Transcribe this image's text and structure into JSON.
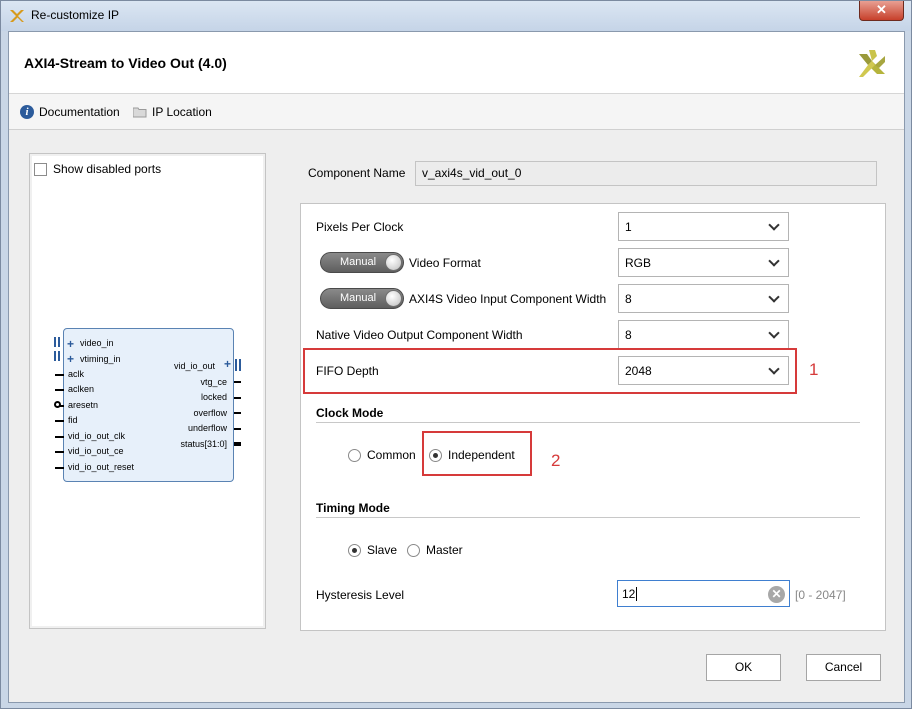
{
  "window": {
    "title": "Re-customize IP",
    "close_glyph": "✕"
  },
  "header": {
    "ip_title": "AXI4-Stream to Video Out (4.0)",
    "logo_icon": "xilinx-logo-icon"
  },
  "toolbar": {
    "documentation": "Documentation",
    "ip_location": "IP Location"
  },
  "symbol": {
    "show_disabled_ports": "Show disabled ports",
    "left_ports": [
      "video_in",
      "vtiming_in",
      "aclk",
      "aclken",
      "aresetn",
      "fid",
      "vid_io_out_clk",
      "vid_io_out_ce",
      "vid_io_out_reset"
    ],
    "right_ports": [
      "vid_io_out",
      "vtg_ce",
      "locked",
      "overflow",
      "underflow",
      "status[31:0]"
    ]
  },
  "component": {
    "label": "Component Name",
    "value": "v_axi4s_vid_out_0"
  },
  "config": {
    "pixels_per_clock": {
      "label": "Pixels Per Clock",
      "value": "1"
    },
    "video_format": {
      "toggle": "Manual",
      "label": "Video Format",
      "value": "RGB"
    },
    "input_width": {
      "toggle": "Manual",
      "label": "AXI4S Video Input Component Width",
      "value": "8"
    },
    "output_width": {
      "label": "Native Video Output Component Width",
      "value": "8"
    },
    "fifo_depth": {
      "label": "FIFO Depth",
      "value": "2048"
    },
    "clock_mode": {
      "title": "Clock Mode",
      "options": [
        "Common",
        "Independent"
      ],
      "selected": "Independent"
    },
    "timing_mode": {
      "title": "Timing Mode",
      "options": [
        "Slave",
        "Master"
      ],
      "selected": "Slave"
    },
    "hysteresis": {
      "label": "Hysteresis Level",
      "value": "12",
      "range": "[0 - 2047]"
    }
  },
  "annotations": {
    "n1": "1",
    "n2": "2",
    "color": "#d63a3a"
  },
  "buttons": {
    "ok": "OK",
    "cancel": "Cancel"
  }
}
